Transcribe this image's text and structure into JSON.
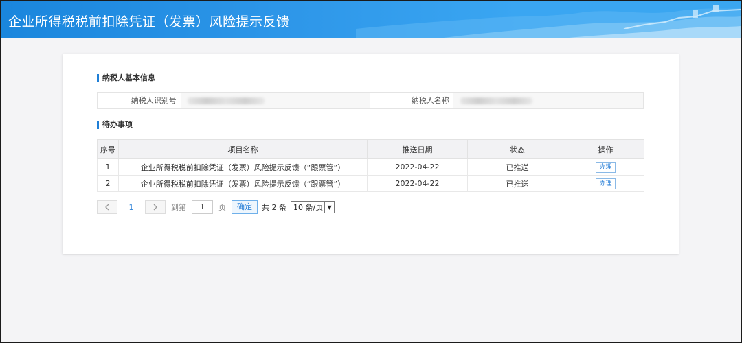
{
  "header": {
    "title": "企业所得税税前扣除凭证（发票）风险提示反馈"
  },
  "taxpayer_section": {
    "title": "纳税人基本信息",
    "id_label": "纳税人识别号",
    "id_value": "",
    "name_label": "纳税人名称",
    "name_value": ""
  },
  "todo_section": {
    "title": "待办事项",
    "columns": [
      "序号",
      "项目名称",
      "推送日期",
      "状态",
      "操作"
    ],
    "rows": [
      {
        "no": "1",
        "name": "企业所得税税前扣除凭证（发票）风险提示反馈（“跟票管”）",
        "date": "2022-04-22",
        "status": "已推送",
        "action": "办理"
      },
      {
        "no": "2",
        "name": "企业所得税税前扣除凭证（发票）风险提示反馈（“跟票管”）",
        "date": "2022-04-22",
        "status": "已推送",
        "action": "办理"
      }
    ]
  },
  "pager": {
    "prev_icon": "chevron-left-icon",
    "next_icon": "chevron-right-icon",
    "current_page": "1",
    "goto_prefix": "到第",
    "goto_value": "1",
    "goto_suffix": "页",
    "confirm_label": "确定",
    "total_text": "共 2 条",
    "page_size": "10 条/页"
  },
  "colors": {
    "header_blue": "#2e97e9",
    "accent_blue": "#2d82d8",
    "section_marker": "#1f7fd6"
  }
}
